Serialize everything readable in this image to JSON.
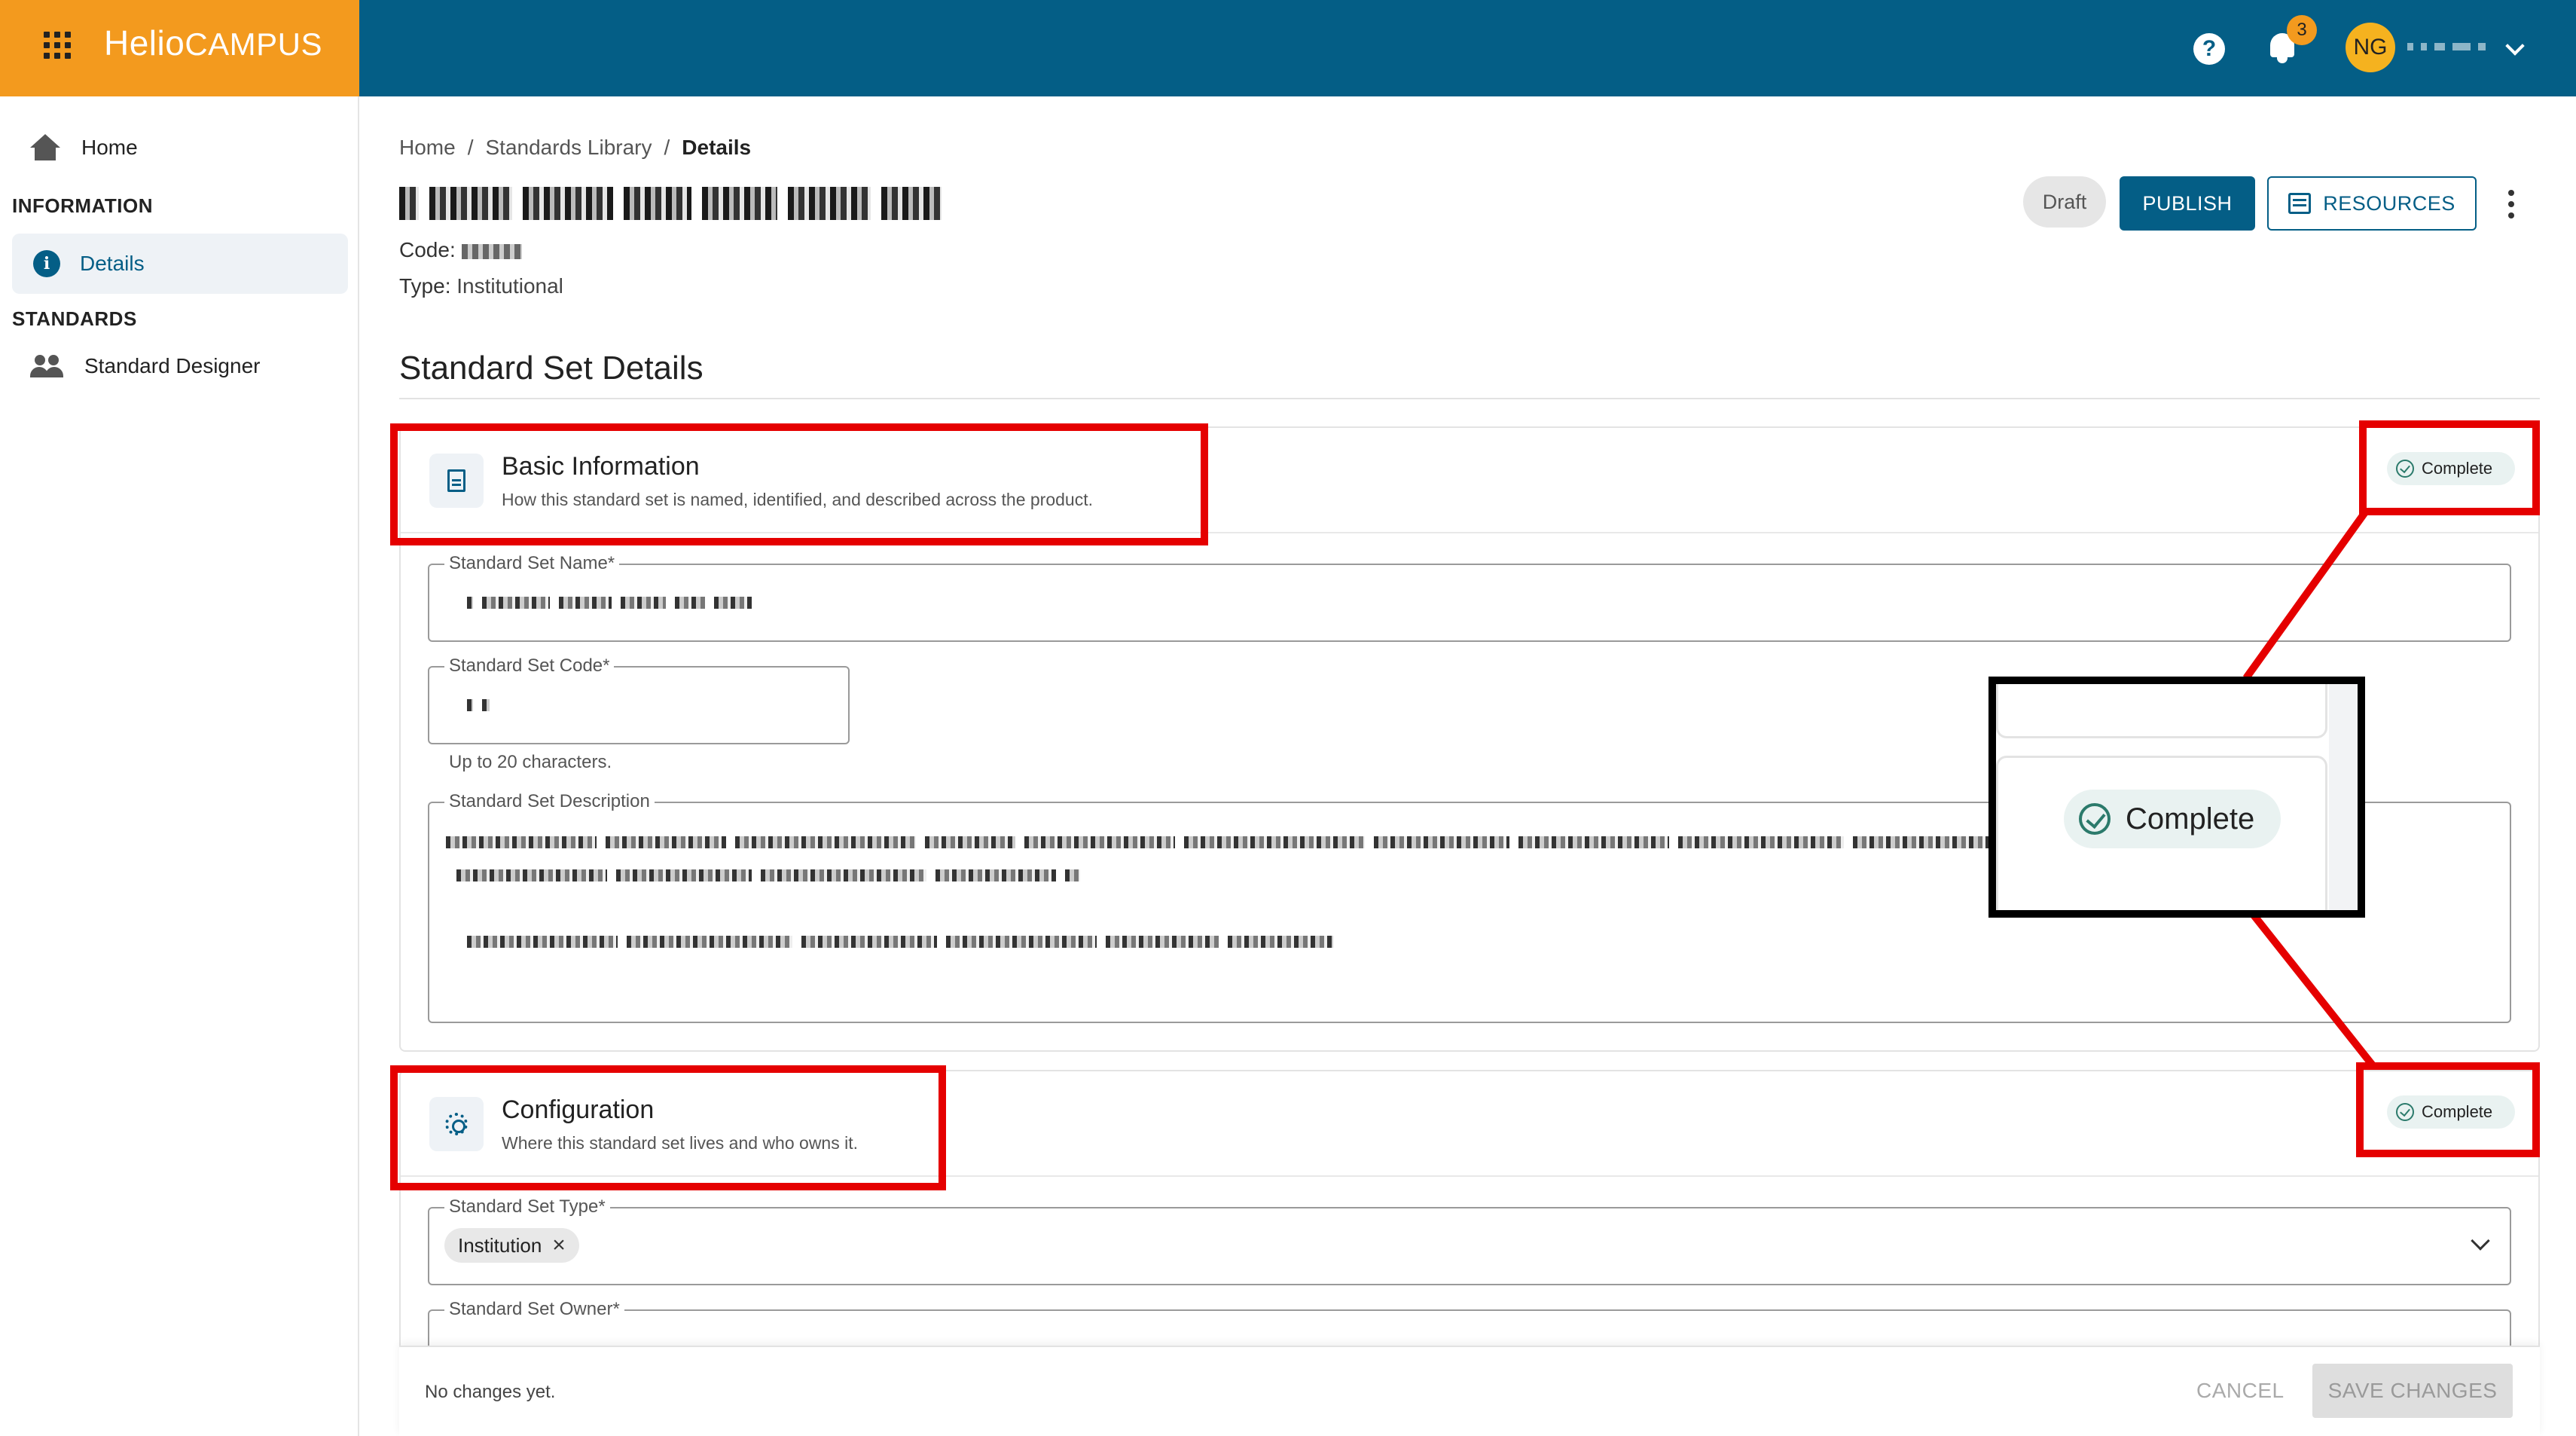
{
  "brand": {
    "name_a": "Helio",
    "name_b": "CAMPUS"
  },
  "header": {
    "help_icon": "?",
    "notification_count": "3",
    "user_initials": "NG"
  },
  "sidebar": {
    "home": "Home",
    "section_information": "INFORMATION",
    "details": "Details",
    "section_standards": "STANDARDS",
    "designer": "Standard Designer"
  },
  "breadcrumb": {
    "home": "Home",
    "sep": "/",
    "library": "Standards Library",
    "current": "Details"
  },
  "page": {
    "code_label": "Code:",
    "type_label": "Type:",
    "type_value": "Institutional",
    "status": "Draft",
    "publish": "PUBLISH",
    "resources": "RESOURCES",
    "section_title": "Standard Set Details"
  },
  "basic": {
    "title": "Basic Information",
    "subtitle": "How this standard set is named, identified, and described across the product.",
    "status": "Complete",
    "name_label": "Standard Set Name",
    "code_label": "Standard Set Code",
    "code_helper": "Up to 20 characters.",
    "desc_label": "Standard Set Description",
    "required": "*"
  },
  "config": {
    "title": "Configuration",
    "subtitle": "Where this standard set lives and who owns it.",
    "status": "Complete",
    "type_label": "Standard Set Type",
    "type_chip": "Institution",
    "owner_label": "Standard Set Owner",
    "required": "*"
  },
  "footer": {
    "message": "No changes yet.",
    "cancel": "CANCEL",
    "save": "SAVE CHANGES"
  },
  "zoom": {
    "status": "Complete"
  },
  "colors": {
    "primary": "#045e86",
    "brand": "#f39a1e",
    "annotation": "#e50000",
    "complete_bg": "#e9f2f1"
  }
}
